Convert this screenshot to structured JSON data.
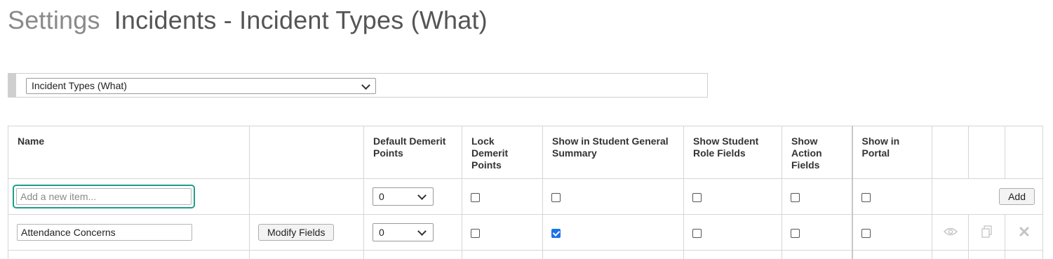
{
  "header": {
    "breadcrumb": "Settings",
    "title": "Incidents - Incident Types (What)"
  },
  "type_selector": {
    "selected": "Incident Types (What)",
    "icon": "chevron-down-icon"
  },
  "table": {
    "columns": [
      "Name",
      "",
      "Default Demerit Points",
      "Lock Demerit Points",
      "Show in Student General Summary",
      "Show Student Role Fields",
      "Show Action Fields",
      "Show in Portal",
      "",
      "",
      ""
    ],
    "new_row": {
      "name_placeholder": "Add a new item...",
      "default_points": "0",
      "lock": false,
      "show_summary": false,
      "show_role": false,
      "show_action": false,
      "show_portal": false,
      "add_label": "Add"
    },
    "rows": [
      {
        "name": "Attendance Concerns",
        "modify_label": "Modify Fields",
        "default_points": "0",
        "lock": false,
        "show_summary": true,
        "show_role": false,
        "show_action": false,
        "show_portal": false,
        "icons": [
          "eye-icon",
          "copy-icon",
          "delete-icon"
        ]
      }
    ]
  },
  "colors": {
    "accent_focus": "#1f9e8a",
    "checkbox_checked": "#1a73e8"
  }
}
